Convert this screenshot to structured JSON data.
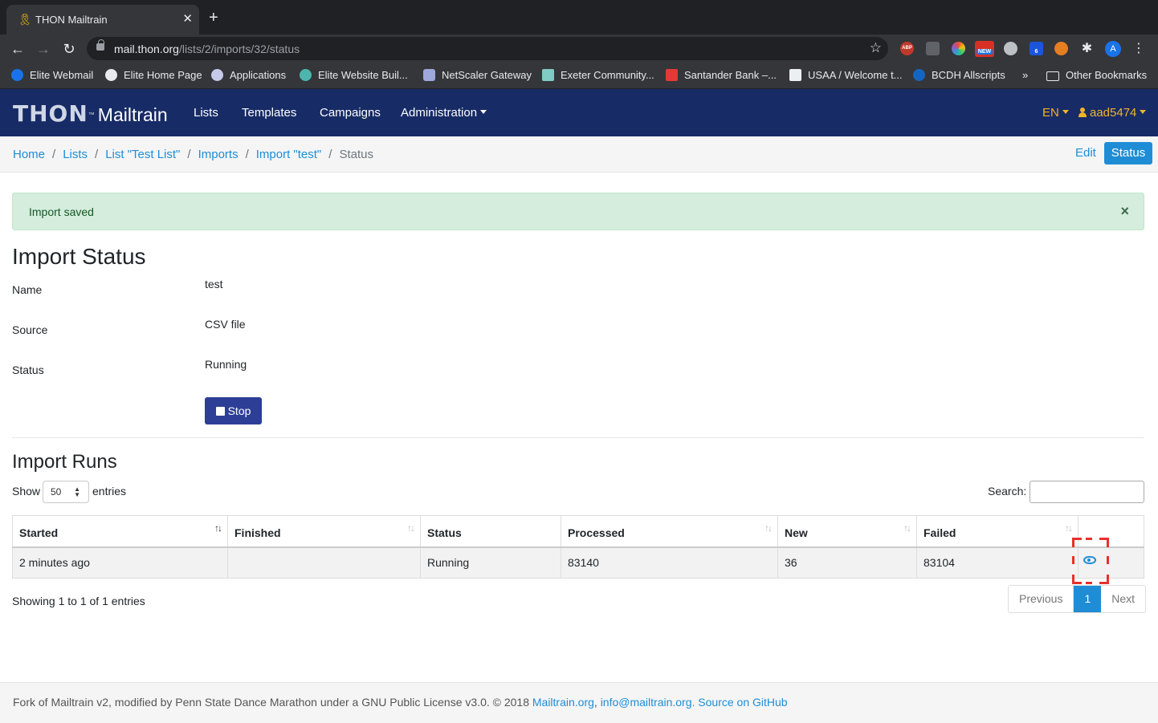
{
  "browser": {
    "tab_title": "THON Mailtrain",
    "url_host": "mail.thon.org",
    "url_path": "/lists/2/imports/32/status",
    "extensions": [
      "ABP",
      "NEW",
      "6"
    ],
    "avatar_letter": "A",
    "bookmarks": [
      "Elite Webmail",
      "Elite Home Page",
      "Applications",
      "Elite Website Buil...",
      "NetScaler Gateway",
      "Exeter Community...",
      "Santander Bank –...",
      "USAA / Welcome t...",
      "BCDH Allscripts",
      "»",
      "Other Bookmarks"
    ]
  },
  "nav": {
    "brand_thon": "THON",
    "brand_tm": "™",
    "brand_app": "Mailtrain",
    "links": [
      "Lists",
      "Templates",
      "Campaigns",
      "Administration"
    ],
    "lang": "EN",
    "user": "aad5474"
  },
  "breadcrumb": {
    "items": [
      "Home",
      "Lists",
      "List \"Test List\"",
      "Imports",
      "Import \"test\""
    ],
    "current": "Status",
    "edit_label": "Edit",
    "status_label": "Status"
  },
  "alert": {
    "message": "Import saved",
    "close": "×"
  },
  "import_status": {
    "title": "Import Status",
    "fields": [
      {
        "label": "Name",
        "value": "test"
      },
      {
        "label": "Source",
        "value": "CSV file"
      },
      {
        "label": "Status",
        "value": "Running"
      }
    ],
    "stop_label": "Stop"
  },
  "import_runs": {
    "title": "Import Runs",
    "show_label": "Show",
    "page_length": "50",
    "entries_label": "entries",
    "search_label": "Search:",
    "search_value": "",
    "columns": [
      "Started",
      "Finished",
      "Status",
      "Processed",
      "New",
      "Failed"
    ],
    "rows": [
      {
        "started": "2 minutes ago",
        "finished": "",
        "status": "Running",
        "processed": "83140",
        "new": "36",
        "failed": "83104"
      }
    ],
    "showing": "Showing 1 to 1 of 1 entries",
    "pagination": {
      "previous": "Previous",
      "current": "1",
      "next": "Next"
    }
  },
  "footer": {
    "text": "Fork of Mailtrain v2, modified by Penn State Dance Marathon under a GNU Public License v3.0. © 2018",
    "link1": "Mailtrain.org",
    "comma": ",",
    "link2": "info@mailtrain.org",
    "dot": ".",
    "link3": "Source on GitHub"
  },
  "colors": {
    "navbar": "#172b66",
    "accent": "#1f8dd6",
    "brand_gold": "#f0b429",
    "alert_bg": "#d4eddd",
    "stop_button": "#2c3e96",
    "highlight": "#e8302a"
  }
}
